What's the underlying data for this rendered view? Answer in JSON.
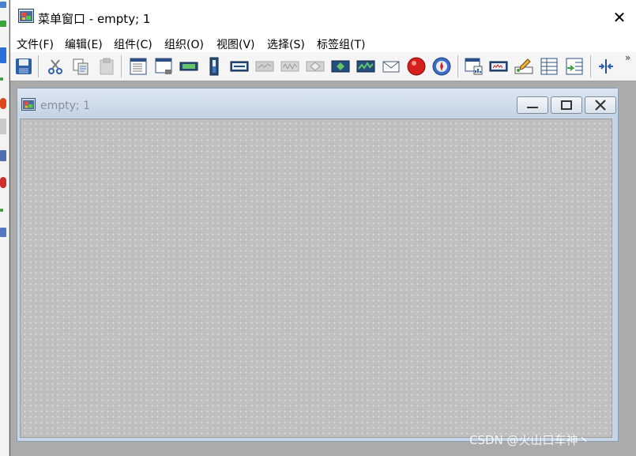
{
  "window": {
    "title": "菜单窗口 - empty; 1",
    "close_glyph": "✕"
  },
  "menu": {
    "items": [
      {
        "label": "文件(F)"
      },
      {
        "label": "编辑(E)"
      },
      {
        "label": "组件(C)"
      },
      {
        "label": "组织(O)"
      },
      {
        "label": "视图(V)"
      },
      {
        "label": "选择(S)"
      },
      {
        "label": "标签组(T)"
      }
    ]
  },
  "toolbar": {
    "buttons": [
      {
        "icon": "save-icon"
      },
      {
        "icon": "cut-icon"
      },
      {
        "icon": "copy-icon"
      },
      {
        "icon": "paste-icon"
      },
      {
        "icon": "window-icon"
      },
      {
        "icon": "window-scaled-icon"
      },
      {
        "icon": "digital-display-icon"
      },
      {
        "icon": "vertical-bar-icon"
      },
      {
        "icon": "numeric-display-icon"
      },
      {
        "icon": "disabled-display-icon"
      },
      {
        "icon": "disabled-trend-icon"
      },
      {
        "icon": "diamond-display-icon"
      },
      {
        "icon": "cross-display-icon"
      },
      {
        "icon": "trend-icon"
      },
      {
        "icon": "mail-icon"
      },
      {
        "icon": "red-ball-icon"
      },
      {
        "icon": "compass-icon"
      },
      {
        "icon": "window-chart-icon"
      },
      {
        "icon": "analog-display-icon"
      },
      {
        "icon": "edit-pencil-icon"
      },
      {
        "icon": "table-icon"
      },
      {
        "icon": "table-export-icon"
      },
      {
        "icon": "split-horizontal-icon"
      }
    ],
    "overflow_glyph": "»"
  },
  "child_window": {
    "title": "empty; 1"
  },
  "watermark": "CSDN @火山口车神丶"
}
